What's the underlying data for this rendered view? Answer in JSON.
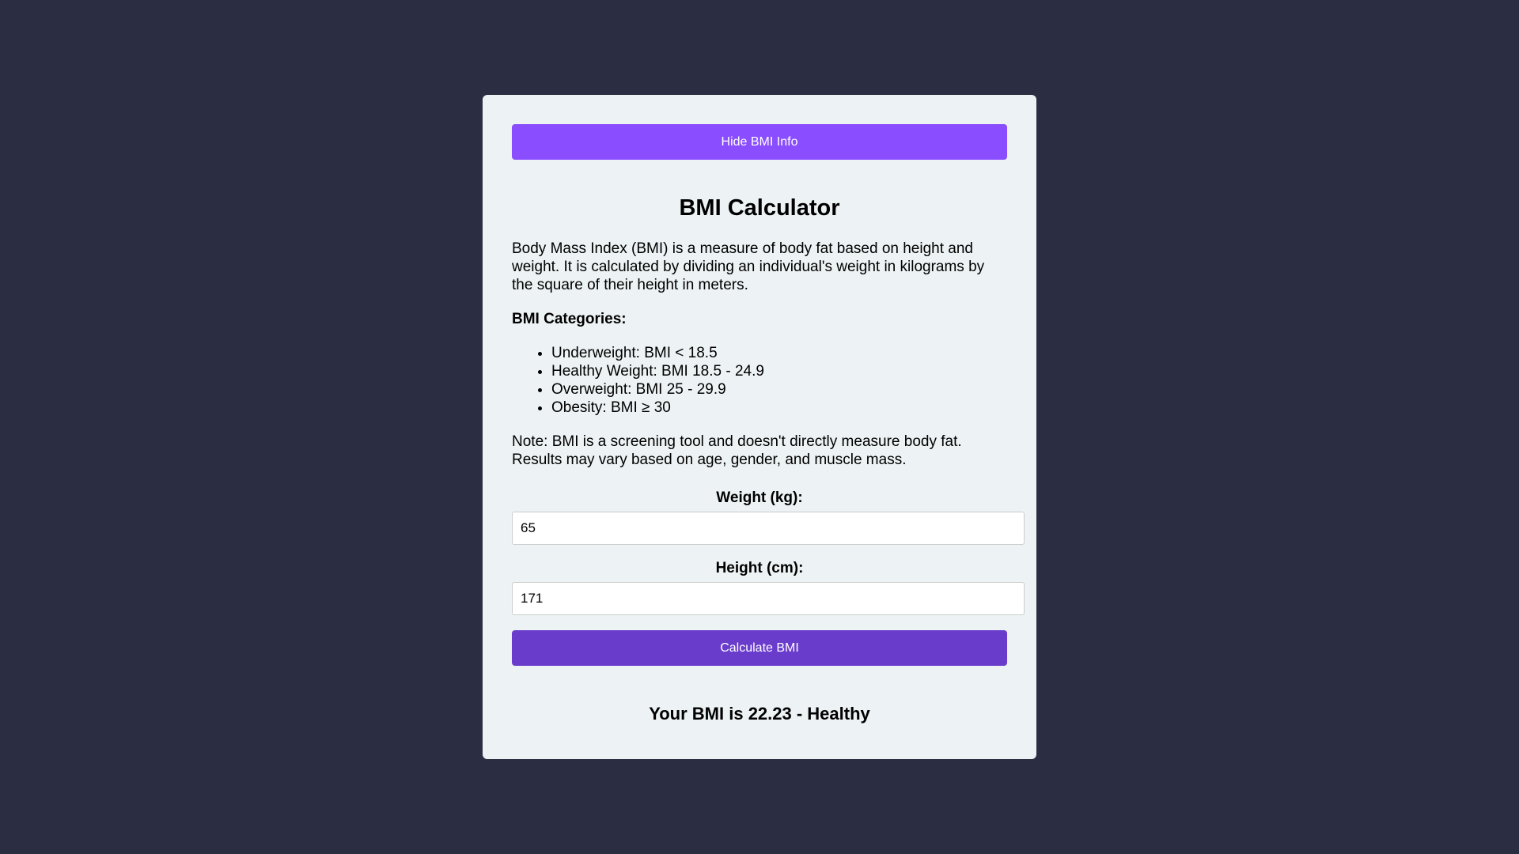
{
  "info_toggle": {
    "label": "Hide BMI Info"
  },
  "title": "BMI Calculator",
  "description": "Body Mass Index (BMI) is a measure of body fat based on height and weight. It is calculated by dividing an individual's weight in kilograms by the square of their height in meters.",
  "categories": {
    "heading": "BMI Categories:",
    "items": [
      "Underweight: BMI < 18.5",
      "Healthy Weight: BMI 18.5 - 24.9",
      "Overweight: BMI 25 - 29.9",
      "Obesity: BMI ≥ 30"
    ]
  },
  "note": "Note: BMI is a screening tool and doesn't directly measure body fat. Results may vary based on age, gender, and muscle mass.",
  "weight": {
    "label": "Weight (kg):",
    "value": "65"
  },
  "height": {
    "label": "Height (cm):",
    "value": "171"
  },
  "calculate": {
    "label": "Calculate BMI"
  },
  "result": "Your BMI is 22.23 - Healthy",
  "colors": {
    "background": "#2b2d42",
    "card": "#edf2f4",
    "toggle_button": "#8a4dff",
    "calculate_button": "#6a3ccc"
  }
}
